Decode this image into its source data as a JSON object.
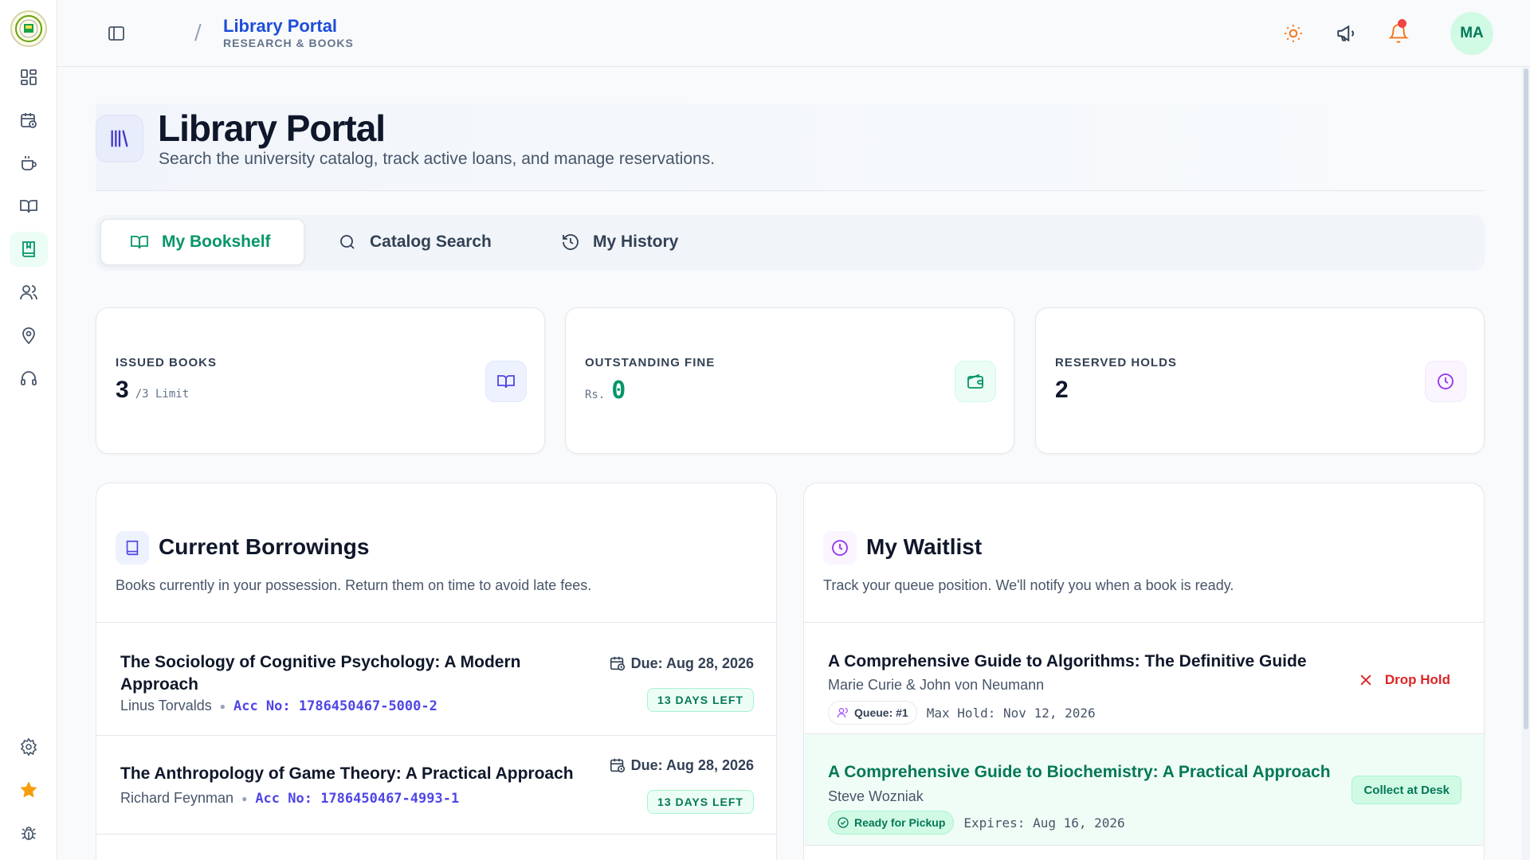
{
  "app": {
    "logo_alt": "University seal"
  },
  "sidebar": {
    "items": [
      {
        "icon": "dashboard-icon"
      },
      {
        "icon": "calendar-clock-icon"
      },
      {
        "icon": "coffee-icon"
      },
      {
        "icon": "open-book-icon"
      },
      {
        "icon": "bookmark-book-icon",
        "active": true
      },
      {
        "icon": "users-icon"
      },
      {
        "icon": "map-pin-icon"
      },
      {
        "icon": "headset-icon"
      }
    ],
    "bottom": [
      {
        "icon": "settings-icon"
      },
      {
        "icon": "star-icon"
      },
      {
        "icon": "bug-icon"
      }
    ]
  },
  "header": {
    "breadcrumb_title": "Library Portal",
    "breadcrumb_sub": "RESEARCH & BOOKS",
    "avatar_initials": "MA"
  },
  "hero": {
    "title": "Library Portal",
    "subtitle": "Search the university catalog, track active loans, and manage reservations."
  },
  "tabs": [
    {
      "label": "My Bookshelf",
      "active": true
    },
    {
      "label": "Catalog Search"
    },
    {
      "label": "My History"
    }
  ],
  "stats": {
    "issued": {
      "label": "ISSUED BOOKS",
      "value": "3",
      "unit": "/3 Limit"
    },
    "fine": {
      "label": "OUTSTANDING FINE",
      "prefix": "Rs.",
      "value": "0"
    },
    "holds": {
      "label": "RESERVED HOLDS",
      "value": "2"
    }
  },
  "borrowings": {
    "title": "Current Borrowings",
    "subtitle": "Books currently in your possession. Return them on time to avoid late fees.",
    "items": [
      {
        "title_line1": "The Sociology of Cognitive Psychology: A Modern",
        "title_line2": "Approach",
        "author": "Linus Torvalds",
        "acc": "Acc No: 1786450467-5000-2",
        "due": "Due: Aug 28, 2026",
        "days_left": "13 DAYS LEFT"
      },
      {
        "title_line1": "The Anthropology of Game Theory: A Practical Approach",
        "author": "Richard Feynman",
        "acc": "Acc No: 1786450467-4993-1",
        "due": "Due: Aug 28, 2026",
        "days_left": "13 DAYS LEFT"
      }
    ]
  },
  "waitlist": {
    "title": "My Waitlist",
    "subtitle": "Track your queue position. We'll notify you when a book is ready.",
    "items": [
      {
        "title": "A Comprehensive Guide to Algorithms: The Definitive Guide",
        "author": "Marie Curie & John von Neumann",
        "queue": "Queue: #1",
        "max_hold": "Max Hold: Nov 12, 2026",
        "action": "Drop Hold"
      },
      {
        "title": "A Comprehensive Guide to Biochemistry: A Practical Approach",
        "author": "Steve Wozniak",
        "status": "Ready for Pickup",
        "expires": "Expires: Aug 16, 2026",
        "action": "Collect at Desk"
      }
    ]
  },
  "colors": {
    "accent": "#059669",
    "brand_blue": "#1d4ed8",
    "danger": "#dc2626",
    "indigo": "#4f46e5",
    "purple": "#9333ea",
    "orange": "#f97316"
  }
}
